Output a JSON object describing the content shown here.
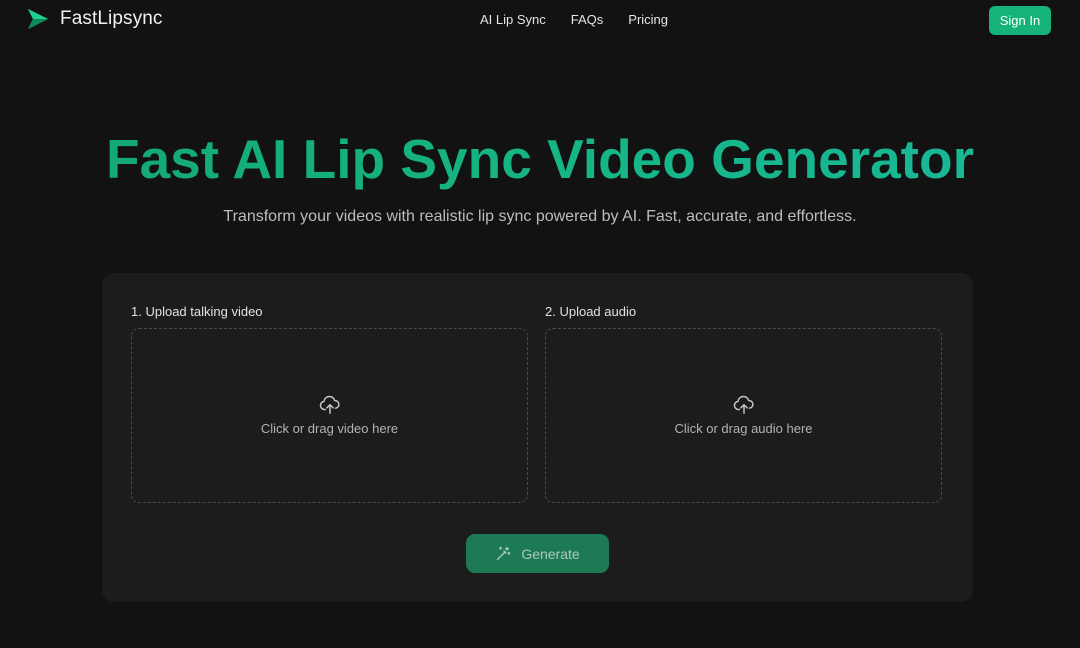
{
  "header": {
    "brand_name": "FastLipsync",
    "nav": [
      "AI Lip Sync",
      "FAQs",
      "Pricing"
    ],
    "signin_label": "Sign In"
  },
  "hero": {
    "title": "Fast AI Lip Sync Video Generator",
    "subtitle": "Transform your videos with realistic lip sync powered by AI. Fast, accurate, and effortless."
  },
  "upload": {
    "video": {
      "label": "1. Upload talking video",
      "prompt": "Click or drag video here",
      "icon": "cloud-upload-icon"
    },
    "audio": {
      "label": "2. Upload audio",
      "prompt": "Click or drag audio here",
      "icon": "cloud-upload-icon"
    }
  },
  "generate": {
    "label": "Generate",
    "icon": "magic-wand-icon"
  },
  "colors": {
    "accent": "#15b27a",
    "background": "#121212",
    "card": "#1c1c1c",
    "generate_disabled": "#1e7a55"
  }
}
